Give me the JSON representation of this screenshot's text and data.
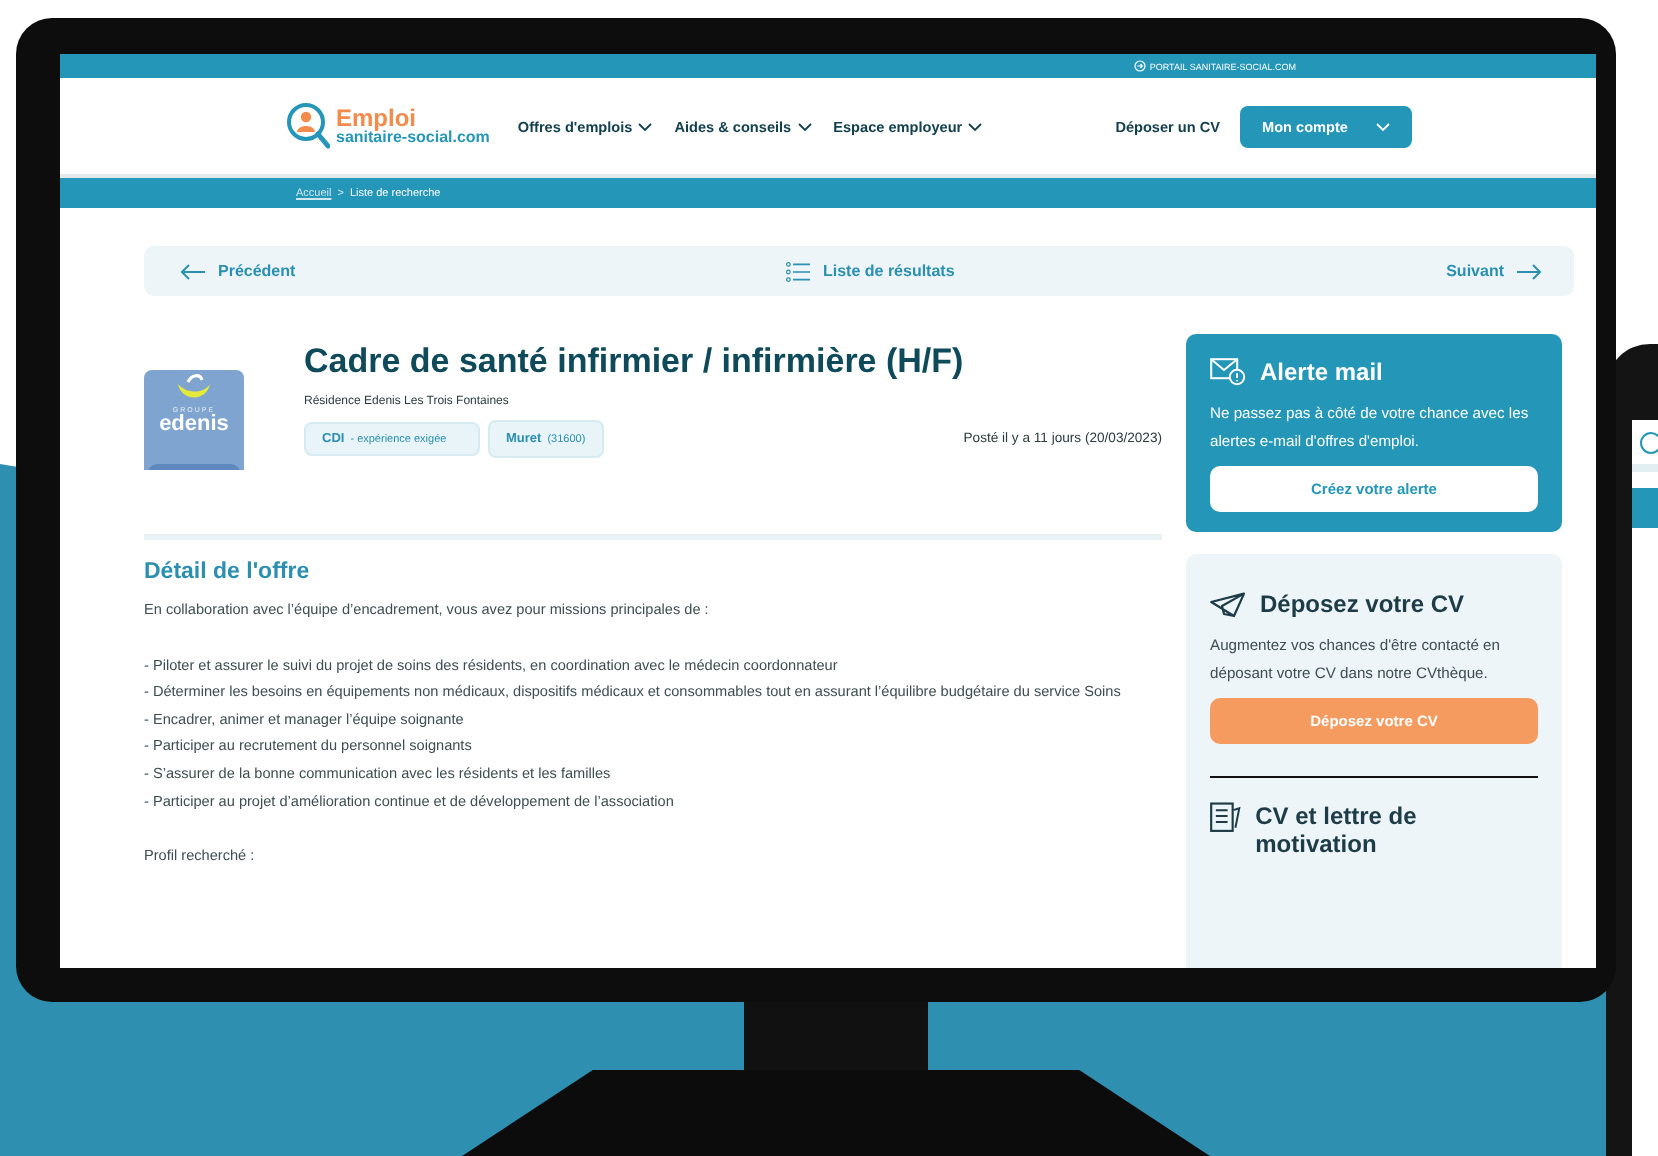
{
  "topbar": {
    "portal_link": "PORTAIL SANITAIRE-SOCIAL.COM"
  },
  "header": {
    "logo": {
      "line1": "Emploi",
      "line2": "sanitaire-social.com"
    },
    "nav": [
      {
        "label": "Offres d'emplois"
      },
      {
        "label": "Aides & conseils"
      },
      {
        "label": "Espace employeur"
      }
    ],
    "cv_link": "Déposer un CV",
    "account_button": "Mon compte"
  },
  "breadcrumb": {
    "home": "Accueil",
    "separator": ">",
    "current": "Liste de recherche"
  },
  "pager": {
    "previous": "Précédent",
    "list": "Liste de résultats",
    "next": "Suivant"
  },
  "offer": {
    "logo": {
      "small": "GROUPE",
      "name": "edenis"
    },
    "title": "Cadre de santé infirmier / infirmière (H/F)",
    "company": "Résidence Edenis Les Trois Fontaines",
    "tags": [
      {
        "label": "CDI",
        "detail": "- expérience exigée"
      },
      {
        "label": "Muret",
        "detail": "(31600)"
      }
    ],
    "posted": "Posté il y a 11 jours (20/03/2023)"
  },
  "detail": {
    "heading": "Détail de l'offre",
    "blocks": [
      [
        "En collaboration avec l’équipe d’encadrement, vous avez pour missions principales de :"
      ],
      [
        "- Piloter et assurer le suivi du projet de soins des résidents, en coordination avec le médecin coordonnateur",
        "- Déterminer les besoins en équipements non médicaux, dispositifs médicaux et consommables tout en assurant l’équilibre budgétaire du service Soins",
        "- Encadrer, animer et manager l’équipe soignante",
        "- Participer au recrutement du personnel soignants",
        "- S’assurer de la bonne communication avec les résidents et les familles",
        "- Participer au projet d’amélioration continue et de développement de l’association"
      ],
      [
        "Profil recherché :"
      ]
    ]
  },
  "alert_card": {
    "title": "Alerte mail",
    "text": "Ne passez pas à côté de votre chance avec les alertes e-mail d'offres d'emploi.",
    "button": "Créez votre alerte"
  },
  "cv_card": {
    "title": "Déposez votre CV",
    "text": "Augmentez vos chances d'être contacté en déposant votre CV dans notre CVthèque.",
    "button": "Déposez votre CV",
    "next_title": "CV et lettre de motivation"
  }
}
